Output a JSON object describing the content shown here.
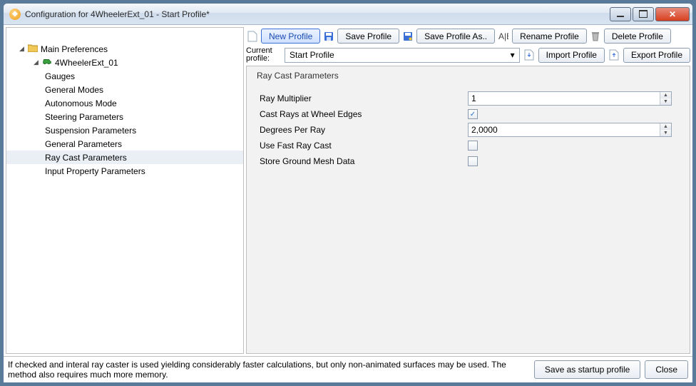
{
  "window": {
    "title": "Configuration for 4WheelerExt_01 - Start Profile*"
  },
  "tree": {
    "root": "Main Preferences",
    "vehicle": "4WheelerExt_01",
    "items": [
      "Gauges",
      "General Modes",
      "Autonomous Mode",
      "Steering Parameters",
      "Suspension Parameters",
      "General Parameters",
      "Ray Cast Parameters",
      "Input Property Parameters"
    ],
    "selected_index": 6
  },
  "toolbar": {
    "new_profile": "New Profile",
    "save_profile": "Save Profile",
    "save_profile_as": "Save Profile As..",
    "rename_profile": "Rename Profile",
    "delete_profile": "Delete Profile",
    "import_profile": "Import Profile",
    "export_profile": "Export Profile",
    "current_profile_label": "Current profile:",
    "current_profile_value": "Start Profile"
  },
  "panel": {
    "group_title": "Ray Cast Parameters",
    "fields": {
      "ray_multiplier": {
        "label": "Ray Multiplier",
        "value": "1"
      },
      "cast_rays_edges": {
        "label": "Cast Rays at Wheel Edges",
        "checked": true
      },
      "degrees_per_ray": {
        "label": "Degrees Per Ray",
        "value": "2,0000"
      },
      "use_fast_ray_cast": {
        "label": "Use Fast Ray Cast",
        "checked": false
      },
      "store_ground_mesh": {
        "label": "Store Ground Mesh Data",
        "checked": false
      }
    }
  },
  "footer": {
    "help": "If checked and interal ray caster is used yielding considerably faster calculations, but only non-animated surfaces may be used. The method also requires much more memory.",
    "save_startup": "Save as startup profile",
    "close": "Close"
  }
}
